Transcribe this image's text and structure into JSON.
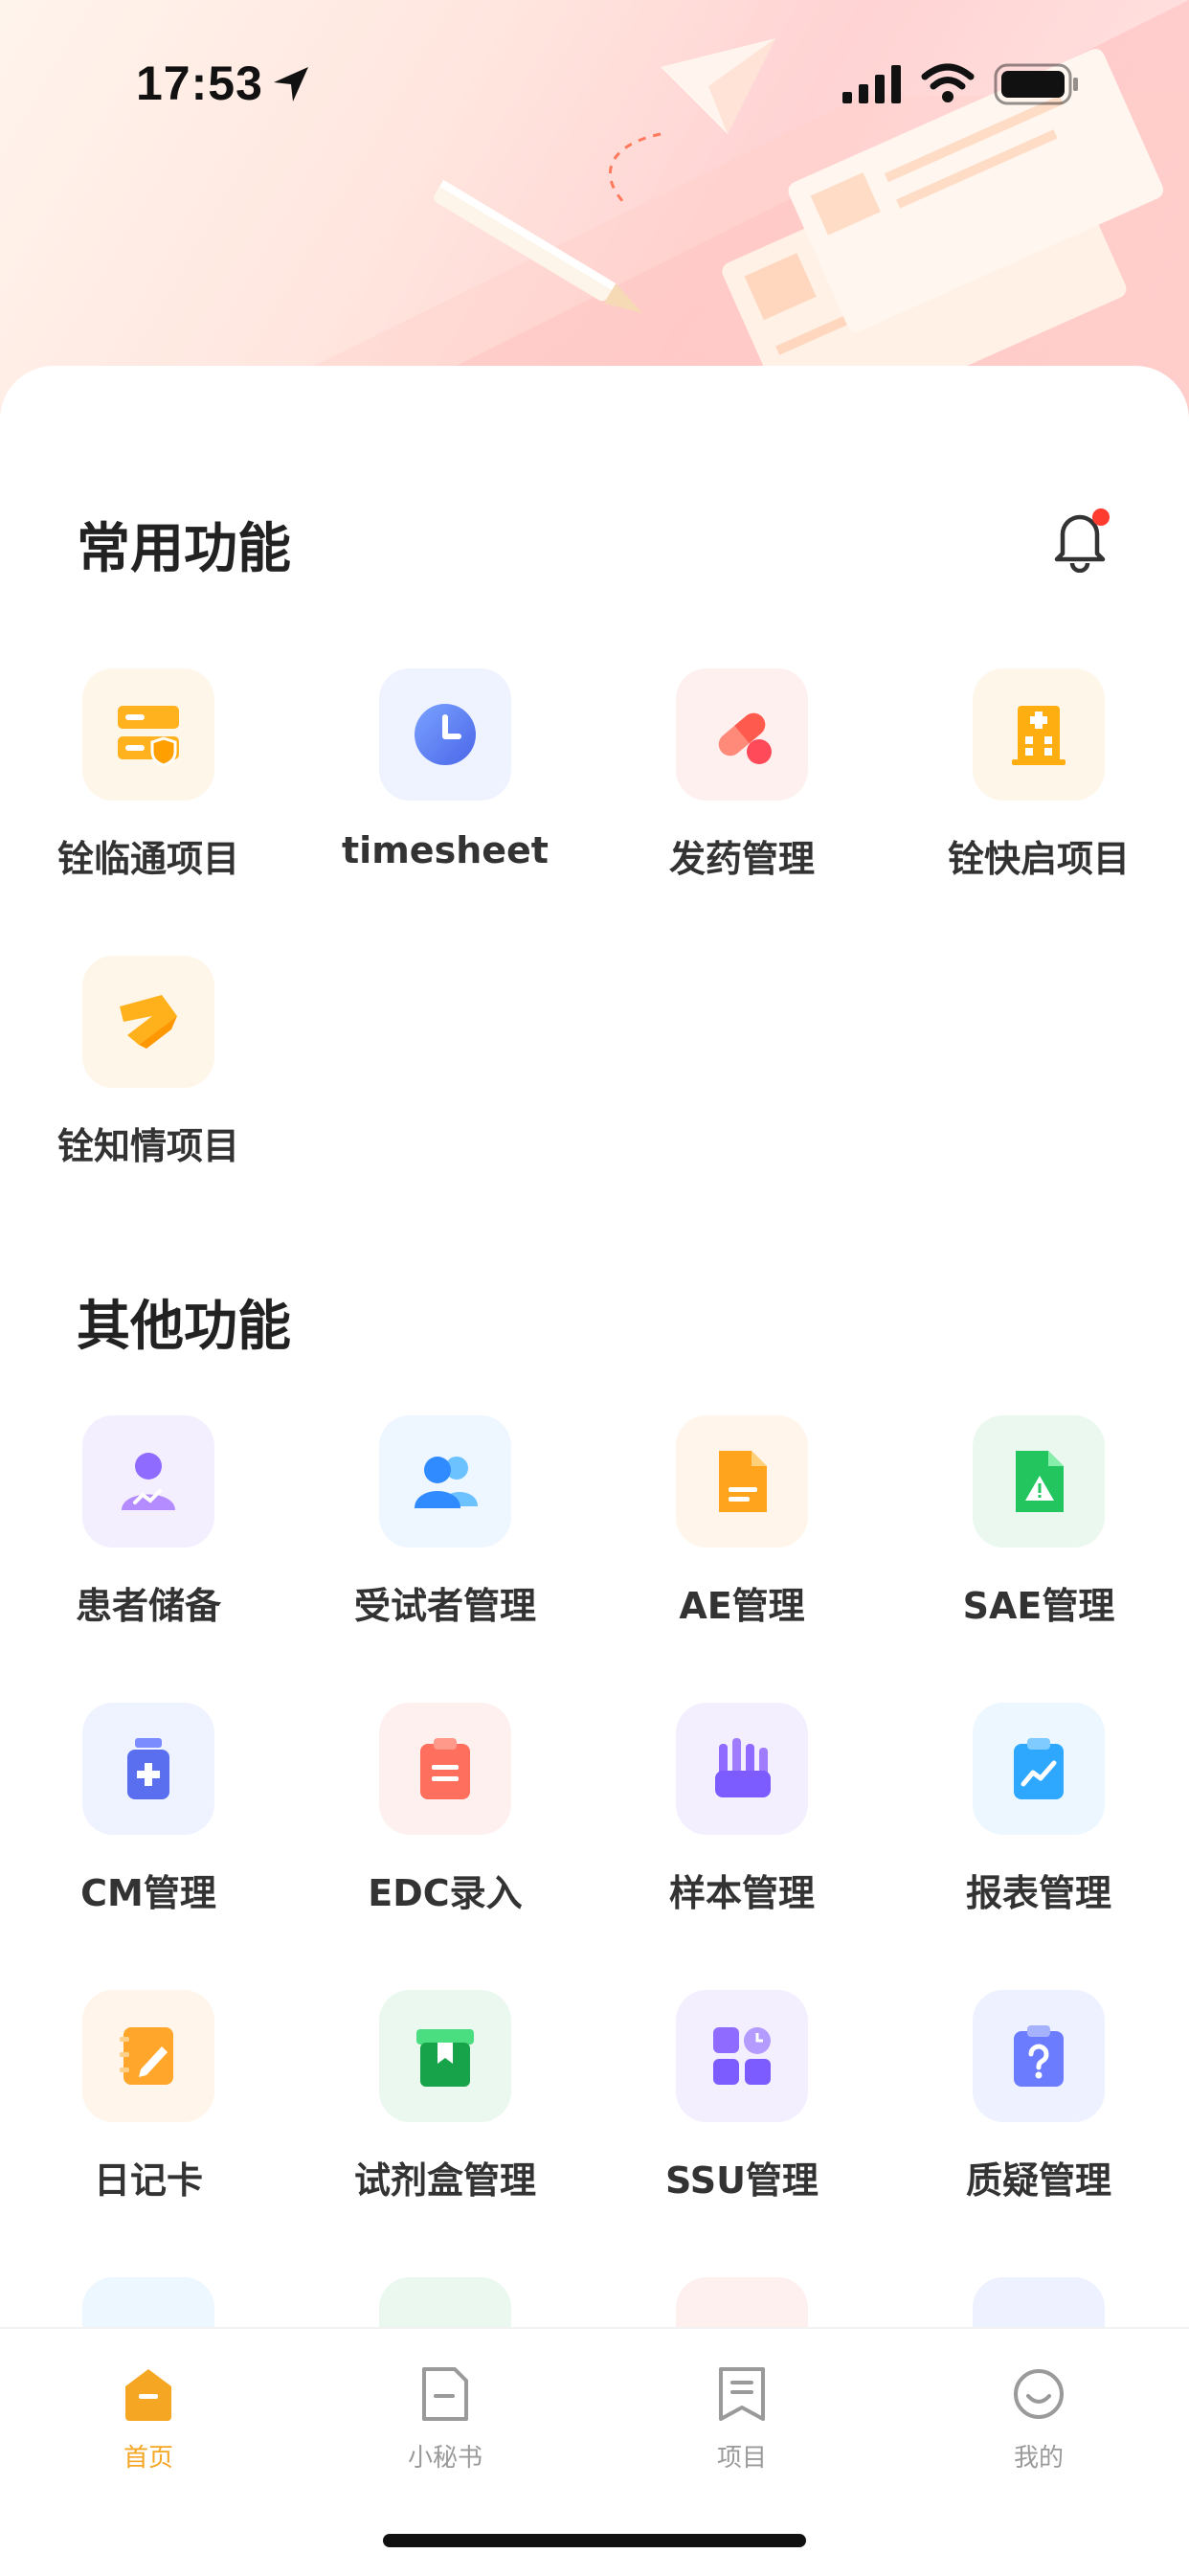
{
  "status_bar": {
    "time": "17:53"
  },
  "common": {
    "title": "常用功能",
    "items": [
      {
        "label": "铨临通项目",
        "icon": "server-shield-icon"
      },
      {
        "label": "timesheet",
        "icon": "clock-icon"
      },
      {
        "label": "发药管理",
        "icon": "pill-icon"
      },
      {
        "label": "铨快启项目",
        "icon": "hospital-building-icon"
      },
      {
        "label": "铨知情项目",
        "icon": "signature-ribbon-icon"
      }
    ]
  },
  "other": {
    "title": "其他功能",
    "items": [
      {
        "label": "患者储备",
        "icon": "patient-icon"
      },
      {
        "label": "受试者管理",
        "icon": "subjects-icon"
      },
      {
        "label": "AE管理",
        "icon": "document-icon"
      },
      {
        "label": "SAE管理",
        "icon": "warning-file-icon"
      },
      {
        "label": "CM管理",
        "icon": "medicine-bottle-icon"
      },
      {
        "label": "EDC录入",
        "icon": "clipboard-icon"
      },
      {
        "label": "样本管理",
        "icon": "test-tubes-icon"
      },
      {
        "label": "报表管理",
        "icon": "chart-clipboard-icon"
      },
      {
        "label": "日记卡",
        "icon": "notebook-pen-icon"
      },
      {
        "label": "试剂盒管理",
        "icon": "kit-box-icon"
      },
      {
        "label": "SSU管理",
        "icon": "apps-grid-icon"
      },
      {
        "label": "质疑管理",
        "icon": "question-clipboard-icon"
      }
    ]
  },
  "tabbar": {
    "tabs": [
      {
        "label": "首页",
        "icon": "home-icon",
        "active": true
      },
      {
        "label": "小秘书",
        "icon": "file-icon",
        "active": false
      },
      {
        "label": "项目",
        "icon": "bookmark-doc-icon",
        "active": false
      },
      {
        "label": "我的",
        "icon": "smile-icon",
        "active": false
      }
    ]
  },
  "colors": {
    "accent": "#f5a623",
    "badge": "#ff3b30",
    "tab_inactive": "#9a9a9a"
  }
}
